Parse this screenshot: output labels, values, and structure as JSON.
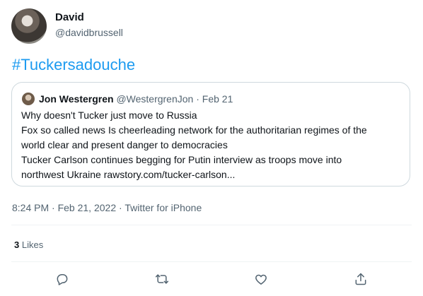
{
  "tweet": {
    "author_name": "David",
    "author_handle": "@davidbrussell",
    "text": "#Tuckersadouche"
  },
  "quoted_tweet": {
    "author_name": "Jon Westergren",
    "author_handle": "@WestergrenJon",
    "separator": "·",
    "date": "Feb 21",
    "lines": [
      "Why doesn't Tucker just move to Russia",
      "Fox so called news Is cheerleading network for the authoritarian regimes of the",
      "world clear and present danger to democracies",
      "Tucker Carlson continues begging for Putin interview as troops move into",
      "northwest Ukraine rawstory.com/tucker-carlson..."
    ]
  },
  "meta": {
    "time": "8:24 PM",
    "separator1": "·",
    "date": "Feb 21, 2022",
    "separator2": "·",
    "source": "Twitter for iPhone"
  },
  "stats": {
    "likes_count": "3",
    "likes_label": "Likes"
  },
  "actions": {
    "reply_icon": "reply-icon",
    "retweet_icon": "retweet-icon",
    "like_icon": "like-icon",
    "share_icon": "share-icon"
  },
  "colors": {
    "link": "#1d9bf0",
    "secondary_text": "#536471",
    "border": "#cfd9de"
  }
}
